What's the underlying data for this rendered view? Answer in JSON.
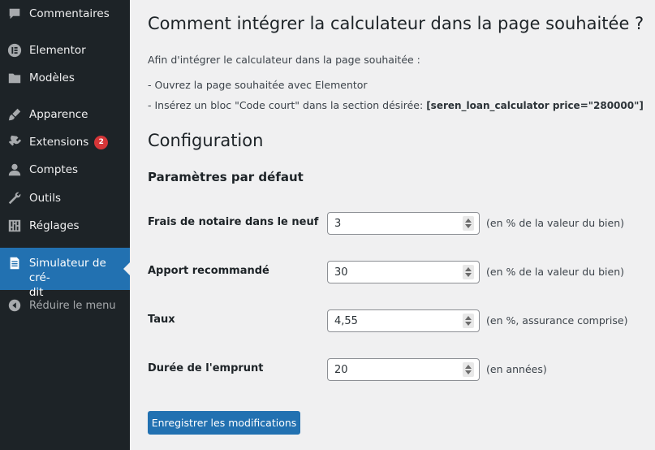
{
  "sidebar": {
    "items": [
      {
        "label": "Commentaires",
        "icon": "comment-icon"
      },
      {
        "label": "Elementor",
        "icon": "elementor-icon"
      },
      {
        "label": "Modèles",
        "icon": "folder-icon"
      },
      {
        "label": "Apparence",
        "icon": "brush-icon"
      },
      {
        "label": "Extensions",
        "icon": "plugin-icon",
        "badge": "2"
      },
      {
        "label": "Comptes",
        "icon": "user-icon"
      },
      {
        "label": "Outils",
        "icon": "wrench-icon"
      },
      {
        "label": "Réglages",
        "icon": "sliders-icon"
      },
      {
        "label_line1": "Simulateur de cré-",
        "label_line2": "dit",
        "icon": "document-icon"
      },
      {
        "label": "Réduire le menu",
        "icon": "collapse-icon"
      }
    ]
  },
  "main": {
    "title": "Comment intégrer la calculateur dans la page souhaitée ?",
    "intro": "Afin d'intégrer le calculateur dans la page souhaitée :",
    "step1": "- Ouvrez la page souhaitée avec Elementor",
    "step2_prefix": "- Insérez un bloc \"Code court\" dans la section désirée: ",
    "shortcode": "[seren_loan_calculator price=\"280000\"]",
    "config_title": "Configuration",
    "defaults_title": "Paramètres par défaut",
    "fields": [
      {
        "label": "Frais de notaire dans le neuf",
        "value": "3",
        "suffix": "(en % de la valeur du bien)"
      },
      {
        "label": "Apport recommandé",
        "value": "30",
        "suffix": "(en % de la valeur du bien)"
      },
      {
        "label": "Taux",
        "value": "4,55",
        "suffix": "(en %, assurance comprise)"
      },
      {
        "label": "Durée de l'emprunt",
        "value": "20",
        "suffix": "(en années)"
      }
    ],
    "save_label": "Enregistrer les modifications"
  },
  "colors": {
    "sidebar_bg": "#1d2327",
    "active_bg": "#2271b1",
    "badge_bg": "#d63638",
    "page_bg": "#f0f0f1"
  }
}
